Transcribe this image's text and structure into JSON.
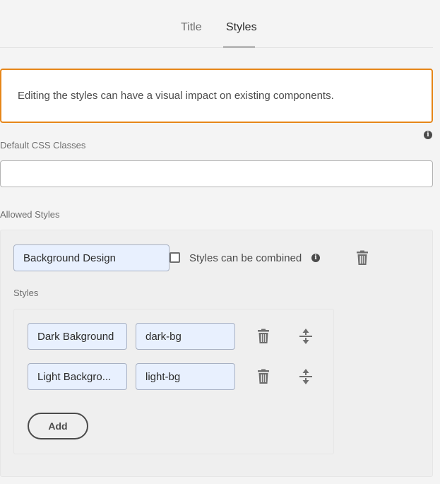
{
  "tabs": [
    {
      "label": "Title",
      "active": false
    },
    {
      "label": "Styles",
      "active": true
    }
  ],
  "alert": {
    "message": "Editing the styles can have a visual impact on existing components.",
    "border_color": "#e68619"
  },
  "default_css": {
    "label": "Default CSS Classes",
    "value": "",
    "info_icon": "info-icon"
  },
  "allowed_styles": {
    "label": "Allowed Styles",
    "group": {
      "name": "Background Design",
      "combine_label": "Styles can be combined",
      "combine_checked": false,
      "info_icon": "info-icon",
      "delete_icon": "trash-icon"
    },
    "styles_label": "Styles",
    "styles": [
      {
        "name": "Dark Bakground",
        "class": "dark-bg"
      },
      {
        "name": "Light Backgro...",
        "class": "light-bg"
      }
    ],
    "add_label": "Add"
  },
  "colors": {
    "background": "#f4f4f4",
    "accent_warning": "#e68619",
    "autofill": "#e8f0fe",
    "icon": "#6e6e6e"
  }
}
